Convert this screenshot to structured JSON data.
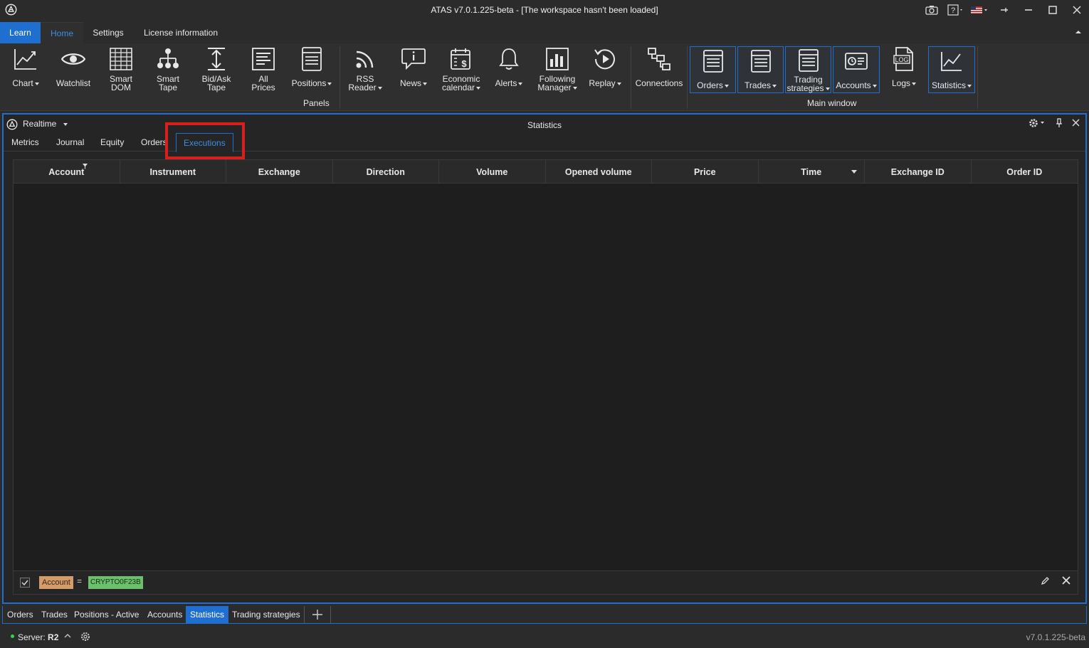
{
  "window": {
    "title": "ATAS v7.0.1.225-beta - [The workspace hasn't been loaded]"
  },
  "ribbon_tabs": {
    "learn": "Learn",
    "home": "Home",
    "settings": "Settings",
    "license": "License information"
  },
  "ribbon": {
    "chart": "Chart",
    "watchlist": "Watchlist",
    "smart_dom_1": "Smart",
    "smart_dom_2": "DOM",
    "smart_tape_1": "Smart",
    "smart_tape_2": "Tape",
    "bidask_1": "Bid/Ask",
    "bidask_2": "Tape",
    "allprices_1": "All",
    "allprices_2": "Prices",
    "positions": "Positions",
    "rss_1": "RSS",
    "rss_2": "Reader",
    "news": "News",
    "econ_1": "Economic",
    "econ_2": "calendar",
    "alerts": "Alerts",
    "following_1": "Following",
    "following_2": "Manager",
    "replay": "Replay",
    "connections": "Connections",
    "orders": "Orders",
    "trades": "Trades",
    "strategies_1": "Trading",
    "strategies_2": "strategies",
    "accounts": "Accounts",
    "logs": "Logs",
    "statistics": "Statistics",
    "group_panels": "Panels",
    "group_main": "Main window",
    "logs_badge": "LOG"
  },
  "panel": {
    "mode": "Realtime",
    "title": "Statistics",
    "tabs": [
      "Metrics",
      "Journal",
      "Equity",
      "Orders",
      "Executions"
    ],
    "active_tab": "Executions"
  },
  "grid": {
    "columns": [
      "Account",
      "Instrument",
      "Exchange",
      "Direction",
      "Volume",
      "Opened volume",
      "Price",
      "Time",
      "Exchange ID",
      "Order ID"
    ],
    "rows": []
  },
  "filter": {
    "field": "Account",
    "operator": "=",
    "value": "CRYPTO0F23B"
  },
  "dock_tabs": [
    "Orders",
    "Trades",
    "Positions - Active",
    "Accounts",
    "Statistics",
    "Trading strategies"
  ],
  "dock_active": "Statistics",
  "status": {
    "server_label": "Server:",
    "server_value": "R2",
    "version": "v7.0.1.225-beta"
  },
  "colors": {
    "accent": "#1e6fd0",
    "highlight": "#d91e1e",
    "filter_field": "#d49b6b",
    "filter_value": "#6cbf6c",
    "status_online": "#3ad04a"
  }
}
